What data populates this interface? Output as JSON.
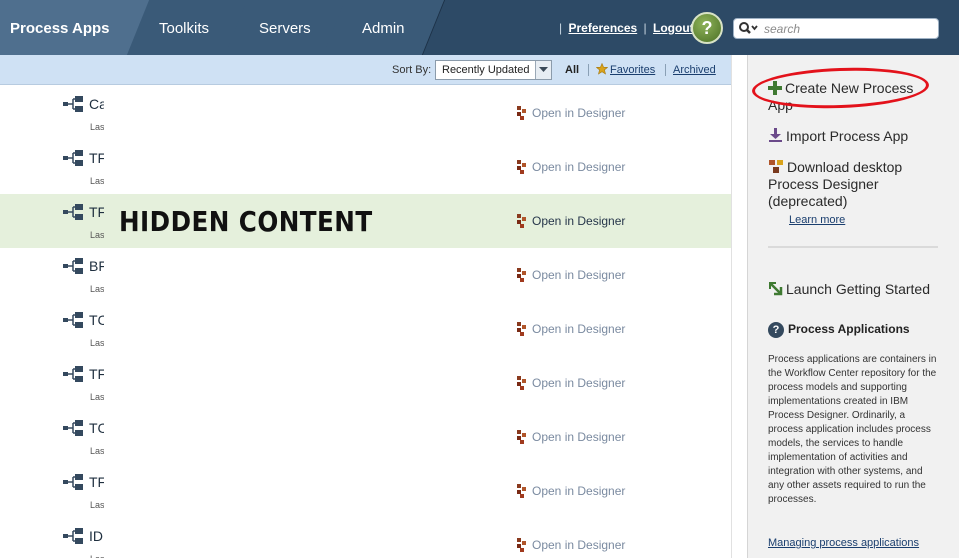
{
  "nav": {
    "tabs": [
      {
        "label": "Process Apps",
        "active": true
      },
      {
        "label": "Toolkits",
        "active": false
      },
      {
        "label": "Servers",
        "active": false
      },
      {
        "label": "Admin",
        "active": false
      }
    ],
    "links": {
      "sep": "|",
      "preferences": "Preferences",
      "logout": "Logout"
    },
    "help": "?",
    "search": {
      "placeholder": "search"
    }
  },
  "sortbar": {
    "label": "Sort By:",
    "selected": "Recently Updated",
    "filters": {
      "all": "All",
      "favorites": "Favorites",
      "archived": "Archived"
    }
  },
  "list": {
    "open_label": "Open in Designer",
    "rows": [
      {
        "name": "Ca",
        "sub": "Las",
        "highlighted": false
      },
      {
        "name": "TF",
        "sub": "Las",
        "highlighted": false
      },
      {
        "name": "TF",
        "sub": "Las",
        "highlighted": true
      },
      {
        "name": "BF",
        "sub": "Las",
        "highlighted": false
      },
      {
        "name": "TC",
        "sub": "Las",
        "highlighted": false
      },
      {
        "name": "TF",
        "sub": "Las",
        "highlighted": false
      },
      {
        "name": "TC",
        "sub": "Las",
        "highlighted": false
      },
      {
        "name": "TF",
        "sub": "Las",
        "highlighted": false
      },
      {
        "name": "ID",
        "sub": "Las",
        "highlighted": false
      }
    ],
    "hidden_label": "HIDDEN CONTENT"
  },
  "sidebar": {
    "create_line1": "Create New Process",
    "create_line2": "App",
    "import": "Import Process App",
    "download_line1": "Download desktop",
    "download_line2": "Process Designer",
    "download_line3": "(deprecated)",
    "learn_more": "Learn more",
    "launch": "Launch Getting Started",
    "pa_title": "Process Applications",
    "pa_desc": "Process applications are containers in the Workflow Center repository for the process models and supporting implementations created in IBM Process Designer. Ordinarily, a process application includes process models, the services to handle implementation of activities and integration with other systems, and any other assets required to run the processes.",
    "pa_link": "Managing process applications"
  },
  "colors": {
    "topbar": "#2d4a66",
    "sortbar": "#cfe1f4",
    "highlight_row": "#e5f0dc",
    "annotation": "#e3121b"
  }
}
